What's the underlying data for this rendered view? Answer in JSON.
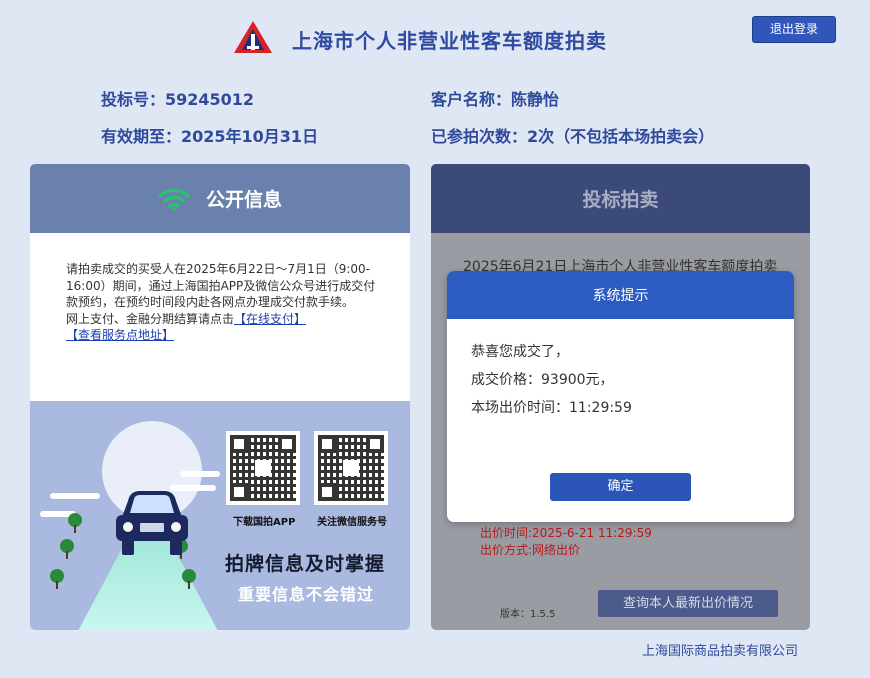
{
  "header": {
    "title": "上海市个人非营业性客车额度拍卖",
    "logout_label": "退出登录",
    "logo_icon": "auction-logo-icon"
  },
  "bidder": {
    "bid_number": "投标号：59245012",
    "customer_name": "客户名称：陈静怡",
    "valid_until": "有效期至：2025年10月31日",
    "participation": "已参拍次数：2次（不包括本场拍卖会）"
  },
  "public_info": {
    "title": "公开信息",
    "icon": "wifi-icon",
    "text_1": "请拍卖成交的买受人在2025年6月22日～7月1日（9:00-16:00）期间，通过上海国拍APP及微信公众号进行成交付款预约，在预约时间段内赴各网点办理成交付款手续。",
    "text_2": "网上支付、金融分期结算请点击",
    "link_online_pay": "【在线支付】",
    "link_service_address": "【查看服务点地址】",
    "qr_app_label": "下载国拍APP",
    "qr_wechat_label": "关注微信服务号",
    "promo_title": "拍牌信息及时掌握",
    "promo_subtitle": "重要信息不会错过"
  },
  "bid_panel": {
    "title": "投标拍卖",
    "behind_title": "2025年6月21日上海市个人非营业性客车额度拍卖",
    "bid_time": "出价时间:2025-6-21 11:29:59",
    "bid_method": "出价方式:网络出价",
    "version": "版本：1.5.5",
    "query_button": "查询本人最新出价情况"
  },
  "modal": {
    "title": "系统提示",
    "line_1": "恭喜您成交了，",
    "line_2": "成交价格：93900元，",
    "line_3": "本场出价时间：11:29:59",
    "ok_label": "确定"
  },
  "footer": {
    "company": "上海国际商品拍卖有限公司"
  },
  "colors": {
    "page_bg": "#dfe7f4",
    "brand_blue": "#2c5bc1",
    "public_header": "#6a80ad",
    "bid_header": "#3c4a7a",
    "error_red": "#b8191b",
    "wifi_green": "#2fbf71"
  }
}
